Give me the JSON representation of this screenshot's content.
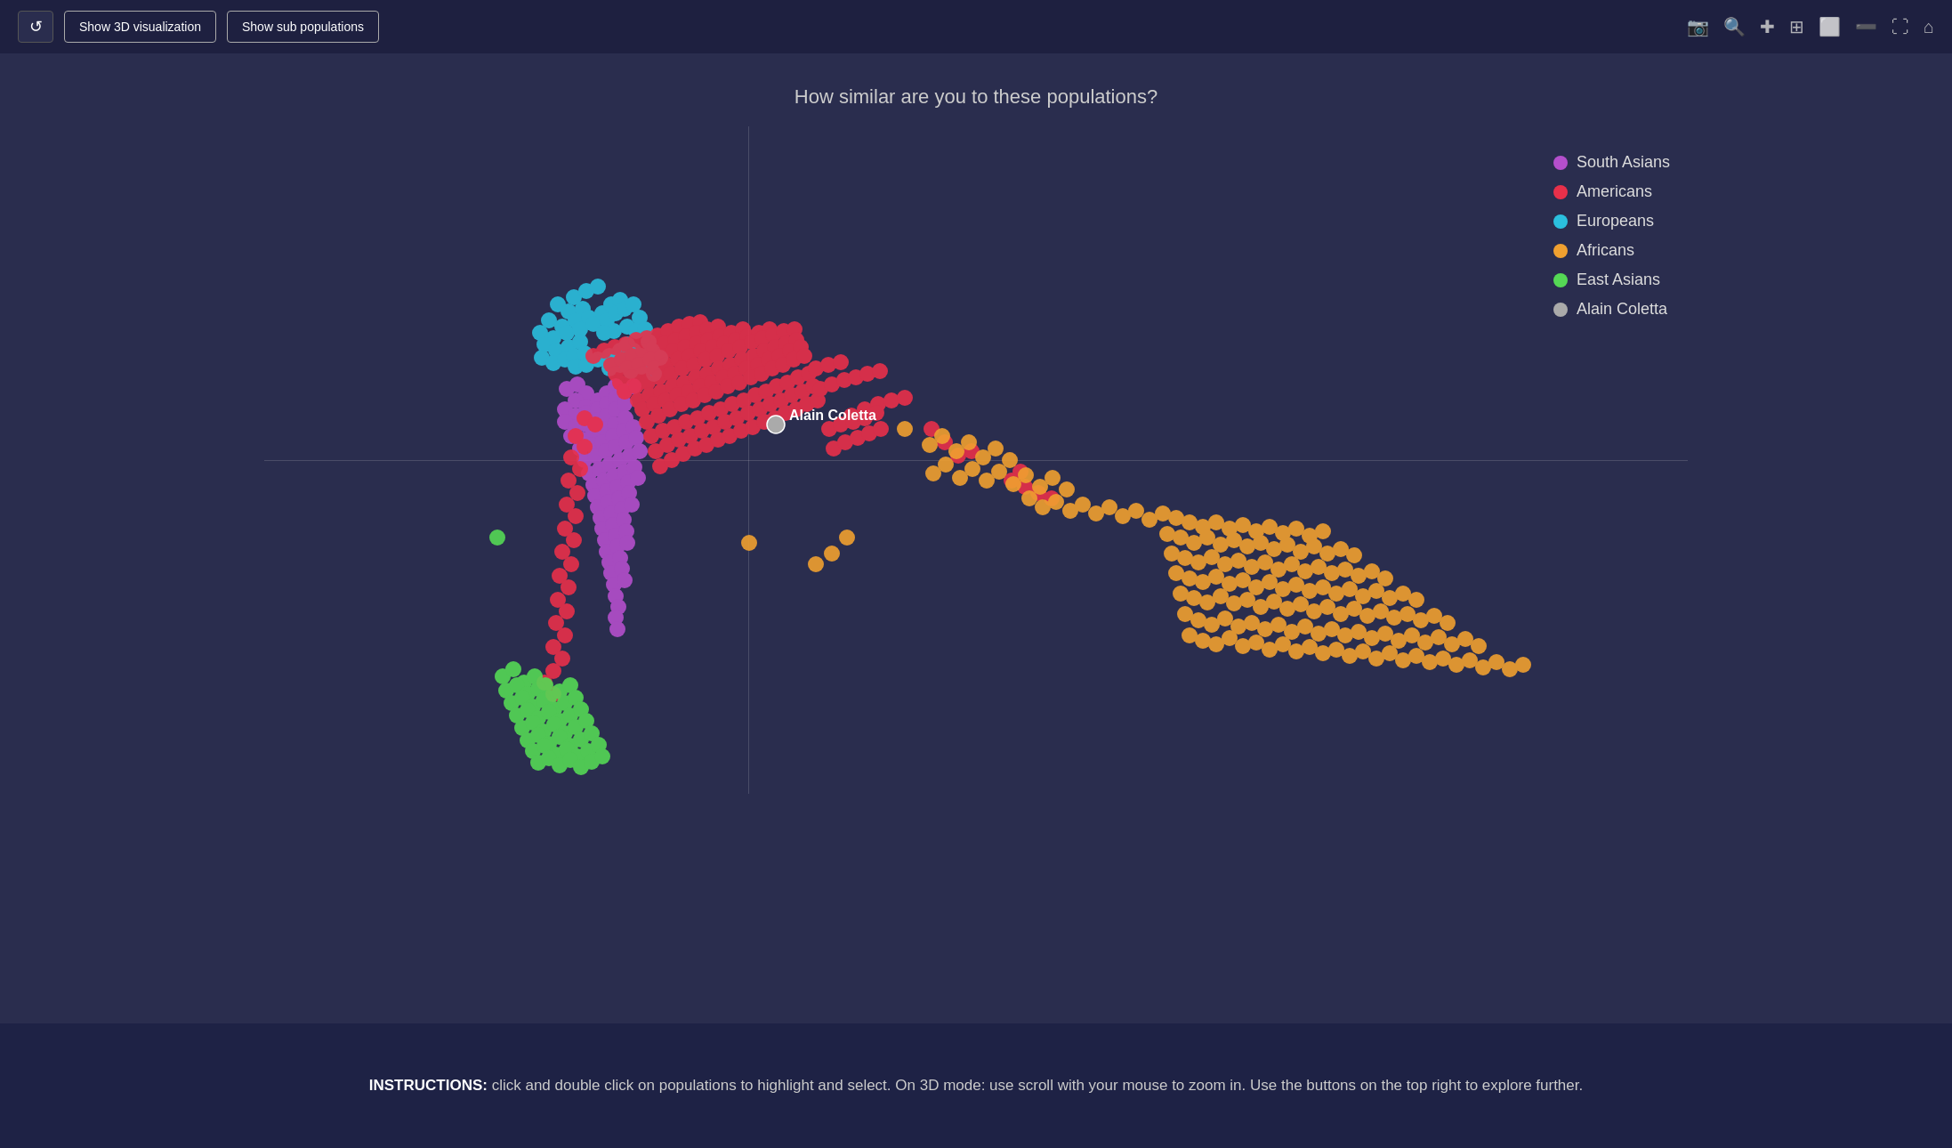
{
  "toolbar": {
    "refresh_label": "↺",
    "show_3d_label": "Show 3D visualization",
    "show_sub_label": "Show sub populations",
    "icons": [
      "📷",
      "🔍",
      "+",
      "⊞",
      "□",
      "⊟",
      "⊠",
      "⌂"
    ]
  },
  "chart": {
    "title": "How similar are you to these populations?",
    "user_label": "Alain Coletta"
  },
  "legend": {
    "items": [
      {
        "label": "South Asians",
        "color": "#b44fcc"
      },
      {
        "label": "Americans",
        "color": "#e8304a"
      },
      {
        "label": "Europeans",
        "color": "#2bbfde"
      },
      {
        "label": "Africans",
        "color": "#f0a030"
      },
      {
        "label": "East Asians",
        "color": "#55d855"
      },
      {
        "label": "Alain Coletta",
        "color": "#aaaaaa"
      }
    ]
  },
  "instructions": {
    "bold": "INSTRUCTIONS:",
    "text": " click and double click on populations to highlight and select. On 3D mode: use scroll with your mouse to zoom in. Use the buttons on the top right to explore further."
  }
}
